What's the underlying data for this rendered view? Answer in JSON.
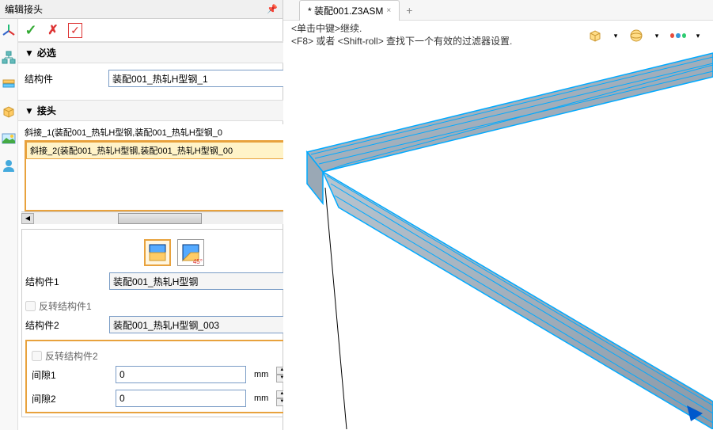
{
  "panel": {
    "title": "编辑接头"
  },
  "sections": {
    "required": "必选",
    "joint": "接头"
  },
  "form": {
    "struct_label": "结构件",
    "struct_value": "装配001_热轧H型钢_1",
    "struct1_label": "结构件1",
    "struct1_value": "装配001_热轧H型钢",
    "struct2_label": "结构件2",
    "struct2_value": "装配001_热轧H型钢_003",
    "reverse1_label": "反转结构件1",
    "reverse2_label": "反转结构件2",
    "gap1_label": "间隙1",
    "gap1_value": "0",
    "gap2_label": "间隙2",
    "gap2_value": "0",
    "unit": "mm"
  },
  "joint_list": {
    "item1": "斜接_1(装配001_热轧H型钢,装配001_热轧H型钢_0",
    "item2": "斜接_2(装配001_热轧H型钢,装配001_热轧H型钢_00"
  },
  "tab": {
    "name": "* 装配001.Z3ASM",
    "close": "×",
    "add": "+"
  },
  "hints": {
    "line1": "<单击中键>继续.",
    "line2": "<F8> 或者 <Shift-roll> 查找下一个有效的过滤器设置."
  },
  "icons": {
    "pin": "↘",
    "ok": "✓",
    "cancel": "✗",
    "apply": "☑",
    "info": "ⓘ",
    "help": "?",
    "collapse": "▼",
    "down": "⬇",
    "dropdown": "▾",
    "left": "◀",
    "right": "▶",
    "angle45": "45°"
  }
}
